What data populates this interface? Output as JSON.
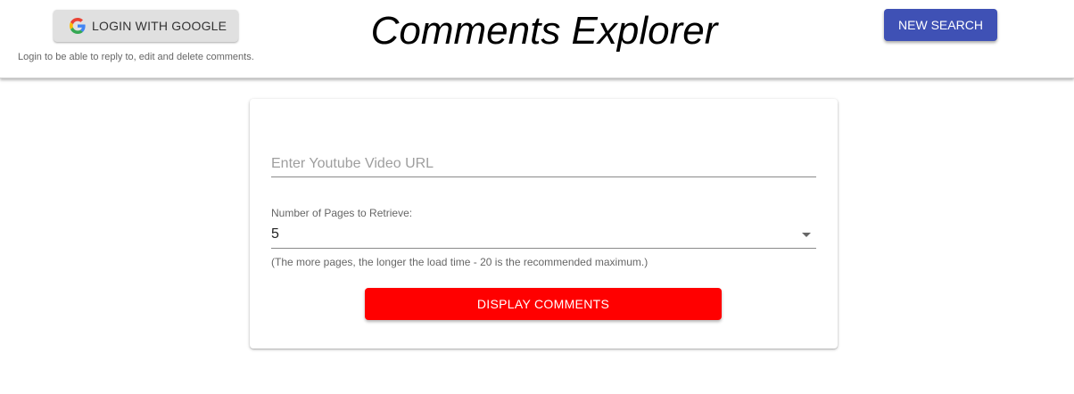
{
  "header": {
    "login_button": {
      "label": "LOGIN WITH GOOGLE",
      "icon": "google-icon"
    },
    "login_hint": "Login to be able to reply to, edit and delete comments.",
    "title": "Comments Explorer",
    "new_search_label": "NEW SEARCH"
  },
  "form": {
    "url_input": {
      "placeholder": "Enter Youtube Video URL",
      "value": ""
    },
    "pages_label": "Number of Pages to Retrieve:",
    "pages_value": "5",
    "pages_hint": "(The more pages, the longer the load time - 20 is the recommended maximum.)",
    "submit_label": "DISPLAY COMMENTS"
  },
  "colors": {
    "primary": "#3f51b5",
    "submit": "#ff0000",
    "login_button_bg": "#e0e0e0"
  }
}
